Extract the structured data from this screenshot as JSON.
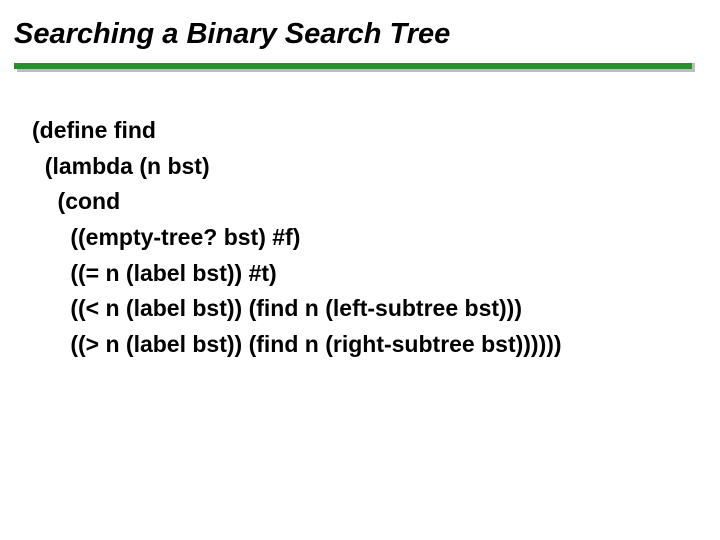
{
  "title": "Searching a Binary Search Tree",
  "code": {
    "l0": "(define find",
    "l1": "  (lambda (n bst)",
    "l2": "    (cond",
    "l3": "      ((empty-tree? bst) #f)",
    "l4": "      ((= n (label bst)) #t)",
    "l5": "      ((< n (label bst)) (find n (left-subtree bst)))",
    "l6": "      ((> n (label bst)) (find n (right-subtree bst))))))"
  }
}
